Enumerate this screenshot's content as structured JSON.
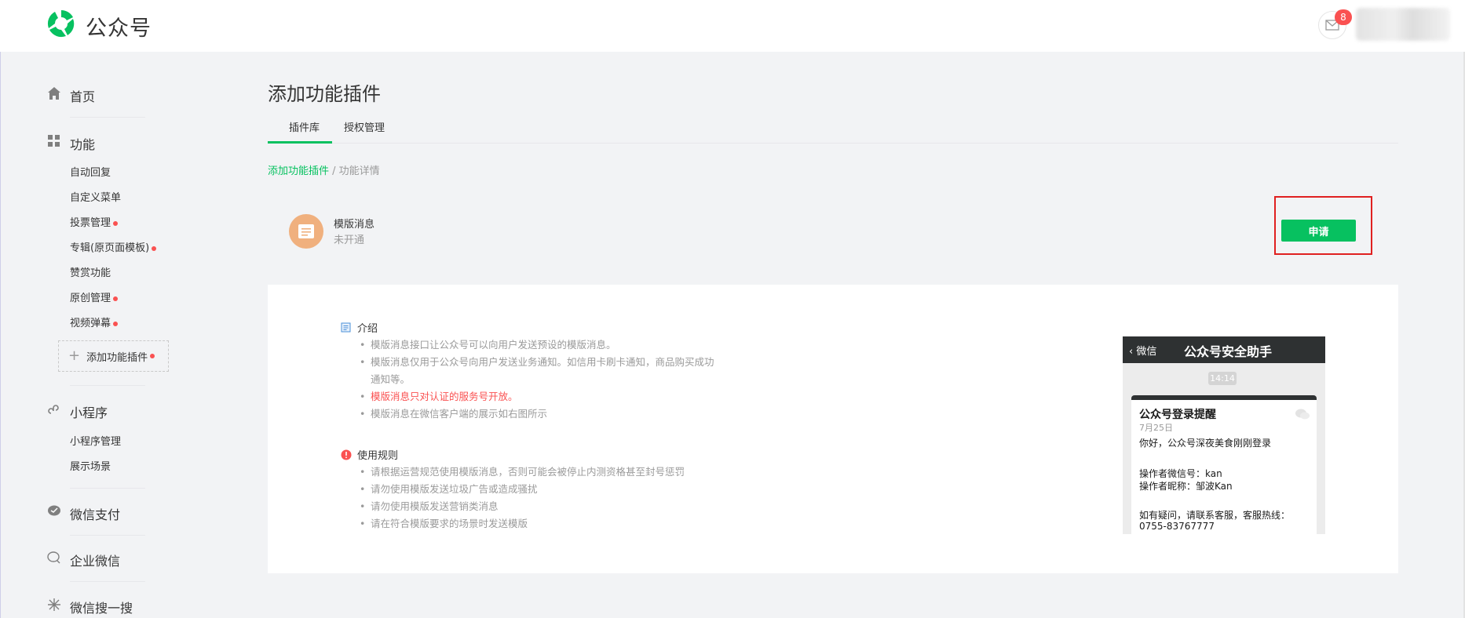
{
  "app": {
    "name": "公众号",
    "brand_color": "#07c160",
    "notification_count": "8"
  },
  "sidebar": {
    "home": "首页",
    "features": {
      "label": "功能",
      "items": [
        {
          "label": "自动回复",
          "dot": false
        },
        {
          "label": "自定义菜单",
          "dot": false
        },
        {
          "label": "投票管理",
          "dot": true
        },
        {
          "label": "专辑(原页面模板)",
          "dot": true
        },
        {
          "label": "赞赏功能",
          "dot": false
        },
        {
          "label": "原创管理",
          "dot": true
        },
        {
          "label": "视频弹幕",
          "dot": true
        }
      ],
      "add_plugin": "添加功能插件"
    },
    "miniprogram": {
      "label": "小程序",
      "items": [
        "小程序管理",
        "展示场景"
      ]
    },
    "pay": "微信支付",
    "work": "企业微信",
    "search": "微信搜一搜"
  },
  "main": {
    "title": "添加功能插件",
    "tabs": [
      "插件库",
      "授权管理"
    ],
    "breadcrumb": {
      "link": "添加功能插件",
      "sep": " / ",
      "current": "功能详情"
    },
    "plugin": {
      "name": "模版消息",
      "status": "未开通",
      "apply_label": "申请"
    },
    "intro": {
      "title": "介绍",
      "bullets": [
        "模版消息接口让公众号可以向用户发送预设的模版消息。",
        "模版消息仅用于公众号向用户发送业务通知。如信用卡刷卡通知，商品购买成功通知等。",
        "模版消息只对认证的服务号开放。",
        "模版消息在微信客户端的展示如右图所示"
      ]
    },
    "rules": {
      "title": "使用规则",
      "bullets": [
        "请根据运营规范使用模版消息，否则可能会被停止内测资格甚至封号惩罚",
        "请勿使用模版发送垃圾广告或造成骚扰",
        "请勿使用模版发送营销类消息",
        "请在符合模版要求的场景时发送模版"
      ]
    },
    "preview": {
      "back": "微信",
      "title": "公众号安全助手",
      "time": "14:14",
      "msg_title": "公众号登录提醒",
      "msg_date": "7月25日",
      "greeting": "你好，公众号深夜美食刚刚登录",
      "operator_id": "操作者微信号：kan",
      "operator_nick": "操作者昵称：邹波Kan",
      "help": "如有疑问，请联系客服，客服热线：",
      "phone": "0755-83767777"
    }
  }
}
